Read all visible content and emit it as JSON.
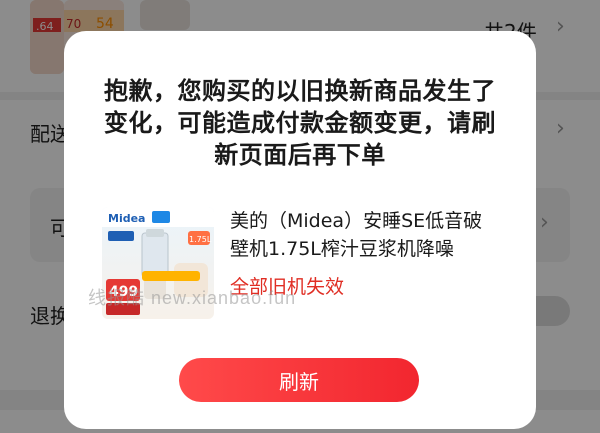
{
  "background": {
    "count_text": "共2件",
    "row1_label": "配送",
    "row2_label": "可",
    "row3_label": "退换",
    "thumb1_price": ".64",
    "thumb1_price2": "70",
    "thumb1_price3": "54"
  },
  "dialog": {
    "title": "抱歉，您购买的以旧换新商品发生了变化，可能造成付款金额变更，请刷新页面后再下单",
    "product": {
      "name": "美的（Midea）安睡SE低音破壁机1.75L榨汁豆浆机降噪",
      "status": "全部旧机失效",
      "image_brand": "Midea",
      "image_price": "499",
      "image_capacity": "1.75L"
    },
    "refresh_label": "刷新"
  },
  "watermark": "线报酷 new.xianbao.fun",
  "colors": {
    "accent_red": "#e02e24",
    "button_gradient_start": "#ff4a4a",
    "button_gradient_end": "#f2262f"
  }
}
